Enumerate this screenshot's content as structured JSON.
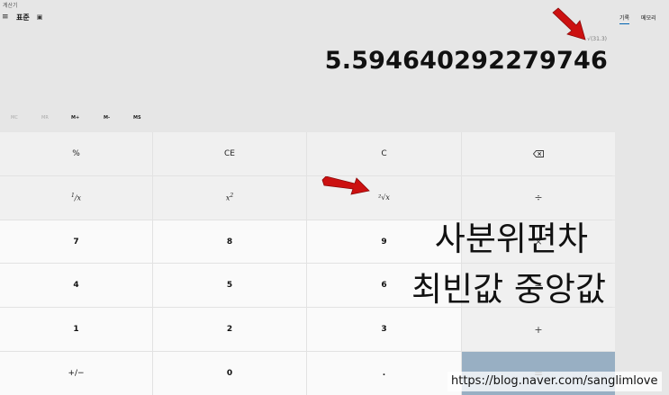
{
  "app": {
    "title": "계산기"
  },
  "header": {
    "menu_icon": "hamburger-icon",
    "mode": "표준",
    "keep_on_top_icon": "compact-overlay-icon"
  },
  "history_tabs": [
    "기록",
    "메모리"
  ],
  "display": {
    "expression": "√(31.3)",
    "value": "5.594640292279746"
  },
  "memory_buttons": [
    "MC",
    "MR",
    "M+",
    "M-",
    "MS"
  ],
  "keys": {
    "percent": "%",
    "ce": "CE",
    "c": "C",
    "backspace_icon": "backspace-icon",
    "reciprocal_num": "1",
    "reciprocal_den": "x",
    "square_base": "x",
    "square_exp": "2",
    "sqrt": "²√x",
    "divide": "÷",
    "seven": "7",
    "eight": "8",
    "nine": "9",
    "multiply": "×",
    "four": "4",
    "five": "5",
    "six": "6",
    "minus": "−",
    "one": "1",
    "two": "2",
    "three": "3",
    "plus": "+",
    "negate": "+/−",
    "zero": "0",
    "decimal": ".",
    "equals": "="
  },
  "overlay": {
    "line1": "사분위편차",
    "line2": "최빈값 중앙값"
  },
  "watermark": "https://blog.naver.com/sanglimlove",
  "colors": {
    "equals_key": "#98afc3",
    "accent": "#0063b1",
    "arrow": "#cc1111"
  }
}
